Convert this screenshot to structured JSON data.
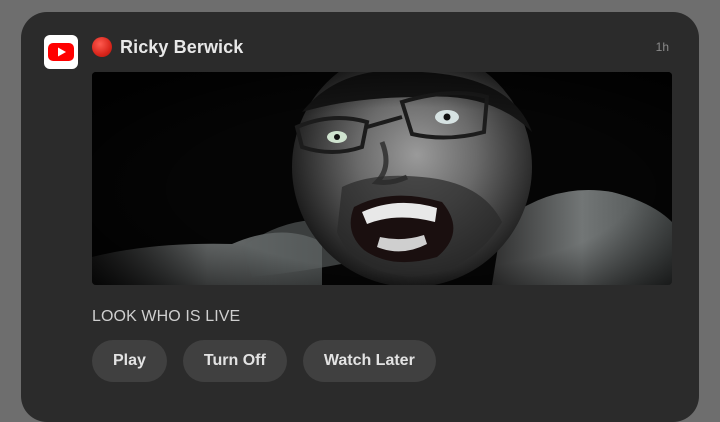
{
  "notification": {
    "app_icon": "youtube-icon",
    "live_indicator_icon": "red-circle-icon",
    "sender": "Ricky Berwick",
    "time": "1h",
    "thumbnail": "video-thumbnail-face",
    "message": "LOOK WHO IS LIVE",
    "actions": [
      {
        "label": "Play"
      },
      {
        "label": "Turn Off"
      },
      {
        "label": "Watch Later"
      }
    ]
  },
  "colors": {
    "background": "#6e6e6e",
    "card": "#2b2b2b",
    "button": "#404040",
    "youtube_red": "#ff0000",
    "live_red": "#d9261c"
  }
}
